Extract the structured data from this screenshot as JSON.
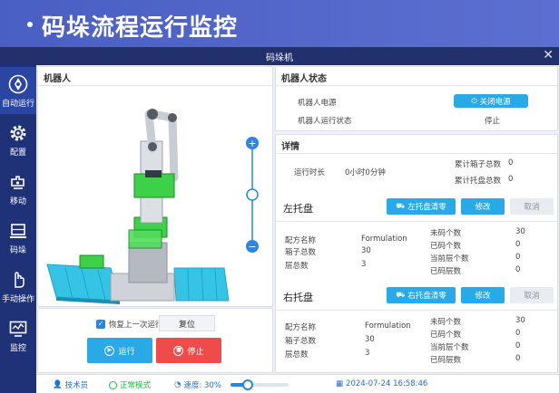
{
  "banner": {
    "title": "码垛流程运行监控"
  },
  "window": {
    "title": "码垛机"
  },
  "sidebar": {
    "items": [
      {
        "label": "自动运行",
        "icon": "auto-run-icon"
      },
      {
        "label": "配置",
        "icon": "config-gear-icon"
      },
      {
        "label": "移动",
        "icon": "move-icon"
      },
      {
        "label": "码垛",
        "icon": "palletize-icon"
      },
      {
        "label": "手动操作",
        "icon": "hand-icon"
      },
      {
        "label": "监控",
        "icon": "monitor-icon"
      }
    ]
  },
  "robot_panel": {
    "title": "机器人",
    "resume_label": "恢复上一次运行",
    "resume_checked": true,
    "reset_label": "复位",
    "run_label": "运行",
    "stop_label": "停止",
    "zoom_plus": "+",
    "zoom_minus": "−",
    "zoom_level": 0.5
  },
  "robot_status": {
    "title": "机器人状态",
    "power_label": "机器人电源",
    "power_button": "关闭电源",
    "run_state_label": "机器人运行状态",
    "run_state_value": "停止"
  },
  "details": {
    "title": "详情",
    "run_time_label": "运行时长",
    "run_time_value": "0小时0分钟",
    "total_boxes_label": "累计箱子总数",
    "total_boxes_value": "0",
    "total_pallets_label": "累计托盘总数",
    "total_pallets_value": "0"
  },
  "left_pallet": {
    "title": "左托盘",
    "clear_button": "左托盘清零",
    "edit_button": "修改",
    "cancel_button": "取消",
    "recipe_label": "配方名称",
    "recipe_value": "Formulation",
    "boxes_label": "箱子总数",
    "boxes_value": "30",
    "layers_label": "层总数",
    "layers_value": "3",
    "uncoded_label": "未码个数",
    "uncoded_value": "30",
    "coded_label": "已码个数",
    "coded_value": "0",
    "current_layer_label": "当前层个数",
    "current_layer_value": "0",
    "coded_layers_label": "已码层数",
    "coded_layers_value": "0"
  },
  "right_pallet": {
    "title": "右托盘",
    "clear_button": "右托盘清零",
    "edit_button": "修改",
    "cancel_button": "取消",
    "recipe_label": "配方名称",
    "recipe_value": "Formulation",
    "boxes_label": "箱子总数",
    "boxes_value": "30",
    "layers_label": "层总数",
    "layers_value": "3",
    "uncoded_label": "未码个数",
    "uncoded_value": "30",
    "coded_label": "已码个数",
    "coded_value": "0",
    "current_layer_label": "当前层个数",
    "current_layer_value": "0",
    "coded_layers_label": "已码层数",
    "coded_layers_value": "0"
  },
  "statusbar": {
    "user": "技术员",
    "mode": "正常模式",
    "speed": "速度: 30%",
    "speed_level": 0.3,
    "datetime": "2024-07-24 16:58:46"
  },
  "colors": {
    "accent": "#29a9e6",
    "stop": "#ef4b4b",
    "sidebar": "#1f3278",
    "banner": "#4a5fc3",
    "pallet": "#35c4e6",
    "box": "#3fd04a"
  }
}
